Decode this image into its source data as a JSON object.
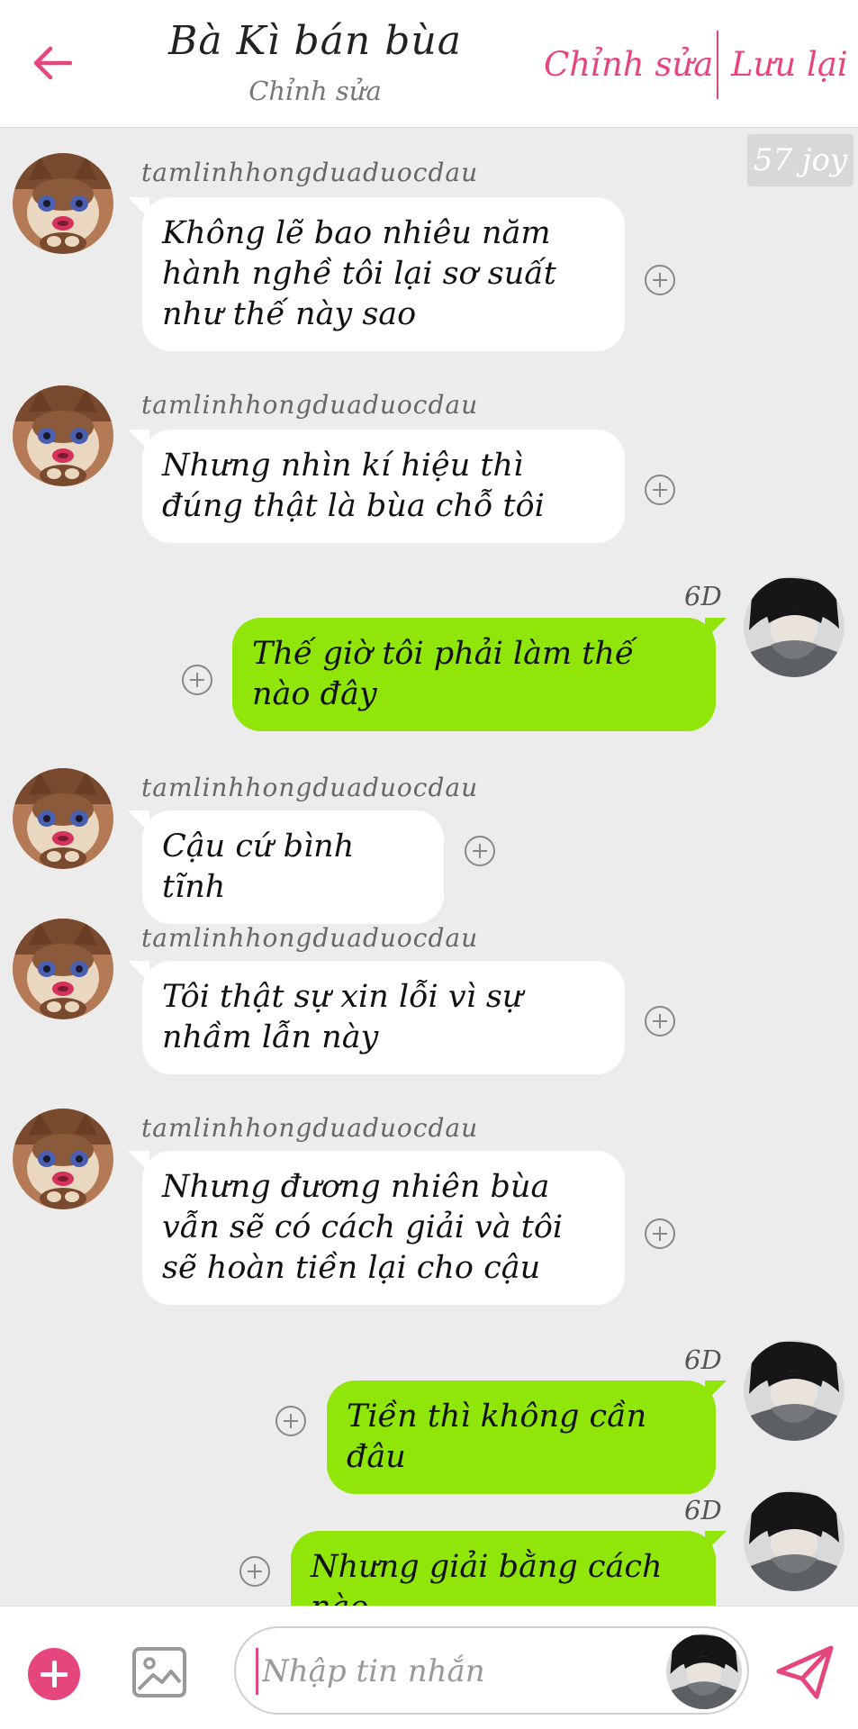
{
  "header": {
    "title": "Bà Kì bán bùa",
    "subtitle": "Chỉnh sửa",
    "edit_label": "Chỉnh sửa",
    "save_label": "Lưu lại"
  },
  "chat": {
    "joy_badge": "57 joy",
    "messages": [
      {
        "sender": "tamlinhhongduaduocdau",
        "text": "Không lẽ bao nhiêu năm hành nghề tôi lại sơ suất như thế này sao"
      },
      {
        "sender": "tamlinhhongduaduocdau",
        "text": "Nhưng nhìn kí hiệu thì đúng thật là bùa chỗ tôi"
      },
      {
        "status": "6D",
        "text": "Thế giờ tôi phải làm thế nào đây"
      },
      {
        "sender": "tamlinhhongduaduocdau",
        "text": "Cậu cứ bình tĩnh"
      },
      {
        "sender": "tamlinhhongduaduocdau",
        "text": "Tôi thật sự xin lỗi vì sự nhầm lẫn này"
      },
      {
        "sender": "tamlinhhongduaduocdau",
        "text": "Nhưng đương nhiên bùa vẫn sẽ có cách giải và tôi sẽ hoàn tiền lại cho cậu"
      },
      {
        "status": "6D",
        "text": "Tiền thì không cần đâu"
      },
      {
        "status": "6D",
        "text": "Nhưng giải bằng cách nào"
      }
    ]
  },
  "composer": {
    "placeholder": "Nhập tin nhắn"
  },
  "icons": {
    "back": "arrow-left-icon",
    "add": "plus-circle-icon",
    "image": "image-icon",
    "send": "send-icon",
    "reaction": "plus-circle-outline-icon"
  },
  "colors": {
    "accent": "#e6467e",
    "outgoing_bubble": "#8fe608",
    "incoming_bubble": "#ffffff",
    "background": "#ececec"
  }
}
